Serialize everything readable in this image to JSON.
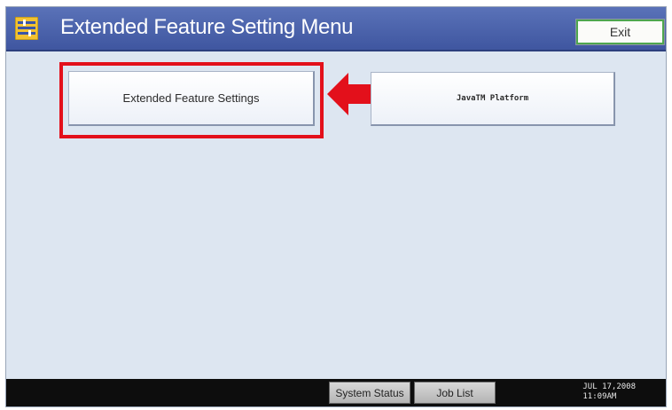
{
  "header": {
    "title": "Extended Feature Setting Menu",
    "exit_label": "Exit",
    "icon": "menu-settings-icon"
  },
  "menu": {
    "extended_feature_settings": "Extended Feature Settings",
    "java_platform": "JavaTM Platform"
  },
  "annotation": {
    "highlight_color": "#e3101b",
    "arrow_icon": "left-arrow-icon"
  },
  "footer": {
    "system_status": "System Status",
    "job_list": "Job List",
    "date": "JUL  17,2008",
    "time": "11:09AM"
  },
  "colors": {
    "titlebar": "#4a62aa",
    "background": "#dde6f1",
    "footer": "#0d0d0d"
  }
}
